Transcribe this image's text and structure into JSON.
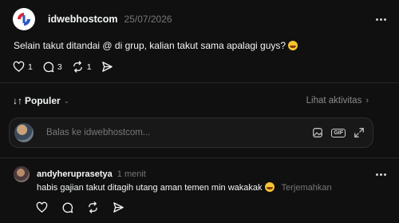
{
  "post": {
    "username": "idwebhostcom",
    "timestamp": "25/07/2026",
    "text": "Selain takut ditandai @ di grup, kalian takut sama apalagi guys?",
    "like_count": "1",
    "comment_count": "3",
    "repost_count": "1"
  },
  "sort": {
    "icon": "↓↑",
    "label": "Populer",
    "activity_label": "Lihat aktivitas"
  },
  "reply": {
    "placeholder": "Balas ke idwebhostcom...",
    "gif_label": "GIF"
  },
  "comment": {
    "username": "andyheruprasetya",
    "timestamp": "1 menit",
    "text": "habis gajian takut ditagih utang aman temen min wakakak",
    "translate_label": "Terjemahkan"
  },
  "colors": {
    "background": "#101010",
    "text": "#f3f5f7",
    "muted": "#777777",
    "brand_red": "#e5243b",
    "brand_blue": "#2b59c3"
  },
  "icons": [
    "logo-icon",
    "more-icon",
    "heart-icon",
    "comment-icon",
    "repost-icon",
    "share-icon",
    "image-icon",
    "gif-icon",
    "expand-icon",
    "emoji-icon"
  ]
}
